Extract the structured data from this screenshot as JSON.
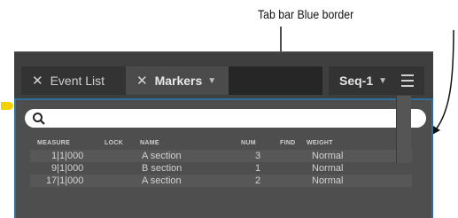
{
  "annotation": {
    "text": "Tab bar Blue border"
  },
  "tabs": [
    {
      "label": "Event List"
    },
    {
      "label": "Markers"
    }
  ],
  "sequence": {
    "label": "Seq-1"
  },
  "columns": [
    "MEASURE",
    "LOCK",
    "NAME",
    "NUM",
    "FIND",
    "WEIGHT"
  ],
  "rows": [
    {
      "measure": "1|1|000",
      "name": "A section",
      "num": "3",
      "weight": "Normal"
    },
    {
      "measure": "9|1|000",
      "name": "B section",
      "num": "1",
      "weight": "Normal"
    },
    {
      "measure": "17|1|000",
      "name": "A section",
      "num": "2",
      "weight": "Normal"
    }
  ],
  "colors": {
    "border": "#2d6f9a",
    "marker": "#f2d200",
    "panel": "#3f3f3f"
  }
}
